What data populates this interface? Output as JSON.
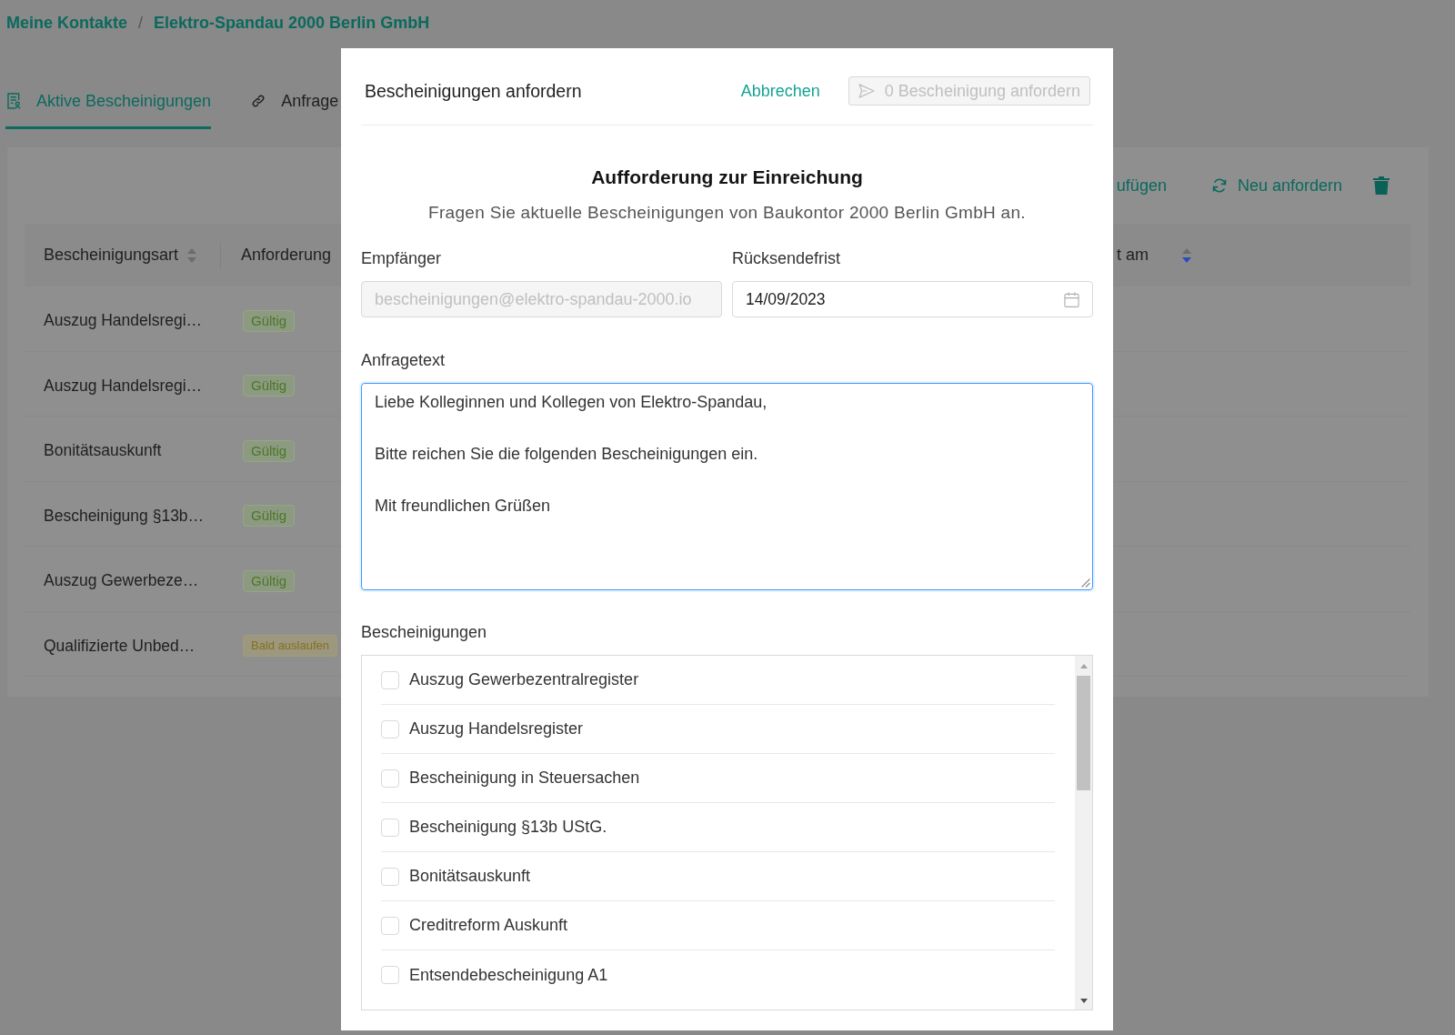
{
  "breadcrumb": {
    "items": [
      {
        "label": "Meine Kontakte"
      },
      {
        "label": "Elektro-Spandau 2000 Berlin GmbH"
      }
    ],
    "separator": "/"
  },
  "tabs": [
    {
      "label": "Aktive Bescheinigungen",
      "selected": true
    },
    {
      "label": "Anfrage",
      "selected": false
    }
  ],
  "toolbar": {
    "actions": [
      {
        "label": "ufügen"
      },
      {
        "label": "Neu anfordern"
      }
    ]
  },
  "table": {
    "columns": [
      {
        "label": "Bescheinigungsart",
        "sortable": true,
        "sort_descending": false
      },
      {
        "label": "Anforderung"
      },
      {
        "label": "t am",
        "sortable": true,
        "sort_descending": true
      }
    ],
    "rows": [
      {
        "name": "Auszug Handelsregi…",
        "status": {
          "label": "Gültig",
          "kind": "valid"
        }
      },
      {
        "name": "Auszug Handelsregi…",
        "status": {
          "label": "Gültig",
          "kind": "valid"
        }
      },
      {
        "name": "Bonitätsauskunft",
        "status": {
          "label": "Gültig",
          "kind": "valid"
        }
      },
      {
        "name": "Bescheinigung §13b…",
        "status": {
          "label": "Gültig",
          "kind": "valid"
        }
      },
      {
        "name": "Auszug Gewerbeze…",
        "status": {
          "label": "Gültig",
          "kind": "valid"
        }
      },
      {
        "name": "Qualifizierte Unbed…",
        "status": {
          "label": "Bald auslaufen",
          "kind": "expiring"
        }
      }
    ]
  },
  "modal": {
    "title": "Bescheinigungen anfordern",
    "cancel": "Abbrechen",
    "submit": {
      "label": "0 Bescheinigung anfordern",
      "disabled": true
    },
    "heading": "Aufforderung zur Einreichung",
    "subtitle": "Fragen Sie aktuelle Bescheinigungen von Baukontor 2000 Berlin GmbH an.",
    "recipient": {
      "label": "Empfänger",
      "value": "bescheinigungen@elektro-spandau-2000.io",
      "disabled": true
    },
    "deadline": {
      "label": "Rücksendefrist",
      "value": "14/09/2023"
    },
    "message": {
      "label": "Anfragetext",
      "value": "Liebe Kolleginnen und Kollegen von Elektro-Spandau,\n\nBitte reichen Sie die folgenden Bescheinigungen ein.\n\nMit freundlichen Grüßen",
      "focused": true
    },
    "certificates": {
      "label": "Bescheinigungen",
      "items": [
        {
          "label": "Auszug Gewerbezentralregister",
          "checked": false
        },
        {
          "label": "Auszug Handelsregister",
          "checked": false
        },
        {
          "label": "Bescheinigung in Steuersachen",
          "checked": false
        },
        {
          "label": "Bescheinigung §13b UStG.",
          "checked": false
        },
        {
          "label": "Bonitätsauskunft",
          "checked": false
        },
        {
          "label": "Creditreform Auskunft",
          "checked": false
        },
        {
          "label": "Entsendebescheinigung A1",
          "checked": false
        }
      ]
    }
  }
}
